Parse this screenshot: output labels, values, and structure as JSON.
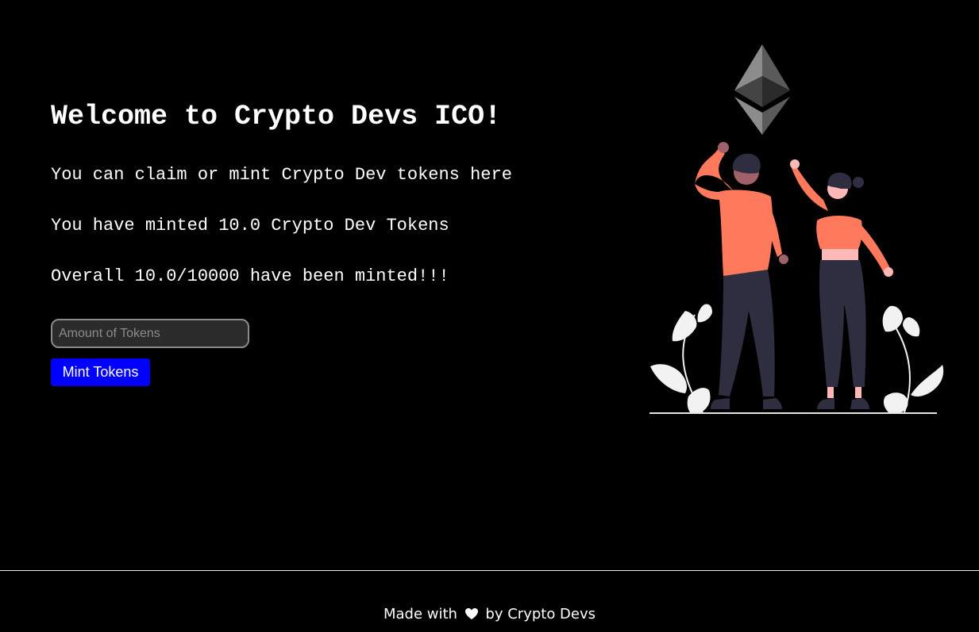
{
  "header": {
    "title": "Welcome to Crypto Devs ICO!"
  },
  "main": {
    "description": "You can claim or mint Crypto Dev tokens here",
    "minted_status": "You have minted 10.0 Crypto Dev Tokens",
    "overall_status": "Overall 10.0/10000 have been minted!!!",
    "amount_input": {
      "placeholder": "Amount of Tokens",
      "value": ""
    },
    "mint_button_label": "Mint Tokens"
  },
  "illustration": {
    "icon": "ethereum-logo-icon",
    "subject": "two-people-reaching-up-illustration"
  },
  "footer": {
    "prefix": "Made with",
    "icon": "heart-icon",
    "suffix": "by Crypto Devs"
  },
  "colors": {
    "background": "#000000",
    "text": "#ffffff",
    "button": "#0000ff",
    "input_background": "#2b2b2b",
    "illustration_accent": "#ff7a5c",
    "illustration_dark": "#2f2e41"
  }
}
